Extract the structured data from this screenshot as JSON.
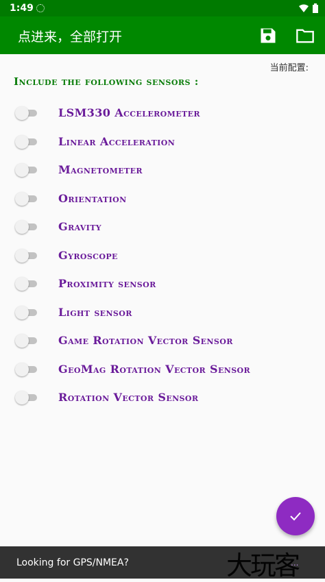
{
  "status_bar": {
    "time": "1:49",
    "icons": [
      "spinner-icon",
      "wifi-icon",
      "battery-icon"
    ]
  },
  "app_bar": {
    "title": "点进来，全部打开",
    "icons": [
      "save-icon",
      "folder-icon"
    ]
  },
  "config_label": "当前配置:",
  "section_heading": "Include the following sensors :",
  "sensors": [
    {
      "label": "LSM330 Accelerometer",
      "enabled": false
    },
    {
      "label": "Linear Acceleration",
      "enabled": false
    },
    {
      "label": "Magnetometer",
      "enabled": false
    },
    {
      "label": "Orientation",
      "enabled": false
    },
    {
      "label": "Gravity",
      "enabled": false
    },
    {
      "label": "Gyroscope",
      "enabled": false
    },
    {
      "label": "Proximity sensor",
      "enabled": false
    },
    {
      "label": "Light sensor",
      "enabled": false
    },
    {
      "label": "Game Rotation Vector Sensor",
      "enabled": false
    },
    {
      "label": "GeoMag Rotation Vector Sensor",
      "enabled": false
    },
    {
      "label": "Rotation Vector Sensor",
      "enabled": false
    }
  ],
  "fab_icon": "check-icon",
  "snackbar": {
    "text": "Looking for GPS/NMEA?",
    "action": "...",
    "watermark": "大玩客"
  },
  "colors": {
    "app_bar": "#008800",
    "heading": "#0a7d0a",
    "sensor_label": "#6a1b9a",
    "fab": "#8e2bc2",
    "snackbar": "#323232"
  }
}
